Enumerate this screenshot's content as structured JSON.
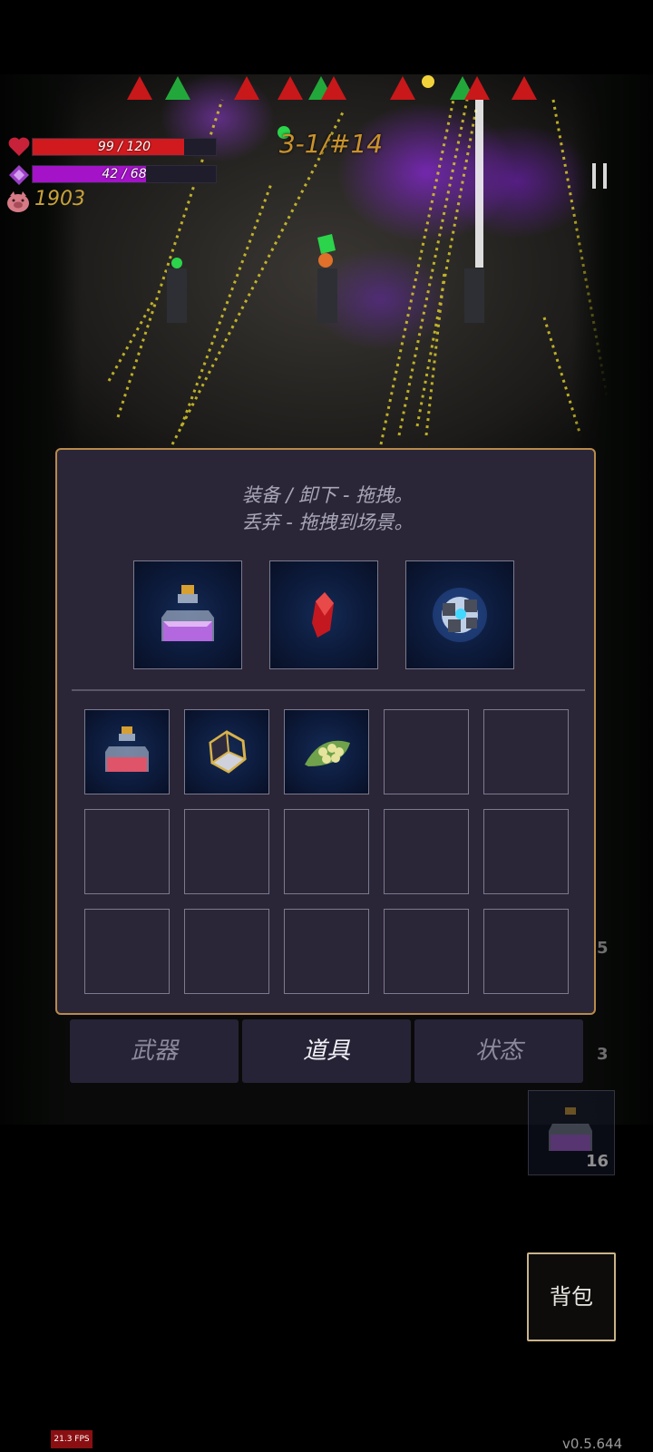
{
  "hud": {
    "hp_text": "99 / 120",
    "hp_fraction": 0.825,
    "mp_text": "42 / 68",
    "mp_fraction": 0.618,
    "coins": "1903",
    "stage": "3-1/#14",
    "colors": {
      "hp": "#d11a1e",
      "mp": "#a413c8",
      "accent": "#c9922c"
    }
  },
  "wave_markers": [
    "red",
    "green",
    "red",
    "red",
    "green",
    "red",
    "red",
    "green",
    "red",
    "red"
  ],
  "inventory": {
    "instruction_line1": "装备 / 卸下 - 拖拽。",
    "instruction_line2": "丢弃 - 拖拽到场景。",
    "equipped": [
      {
        "icon": "purple-potion-icon"
      },
      {
        "icon": "red-crystal-icon"
      },
      {
        "icon": "blue-orb-core-icon"
      }
    ],
    "slots_row1": [
      {
        "icon": "red-potion-icon"
      },
      {
        "icon": "golden-icosahedron-icon"
      },
      {
        "icon": "seed-leaf-icon"
      },
      {
        "icon": ""
      },
      {
        "icon": ""
      }
    ]
  },
  "tabs": [
    {
      "label": "武器",
      "active": false
    },
    {
      "label": "道具",
      "active": true
    },
    {
      "label": "状态",
      "active": false
    }
  ],
  "side": {
    "count_1": "5",
    "count_2": "3",
    "quick_item_count": "16"
  },
  "bag_button": "背包",
  "fps": "21.3 FPS",
  "version": "v0.5.644"
}
